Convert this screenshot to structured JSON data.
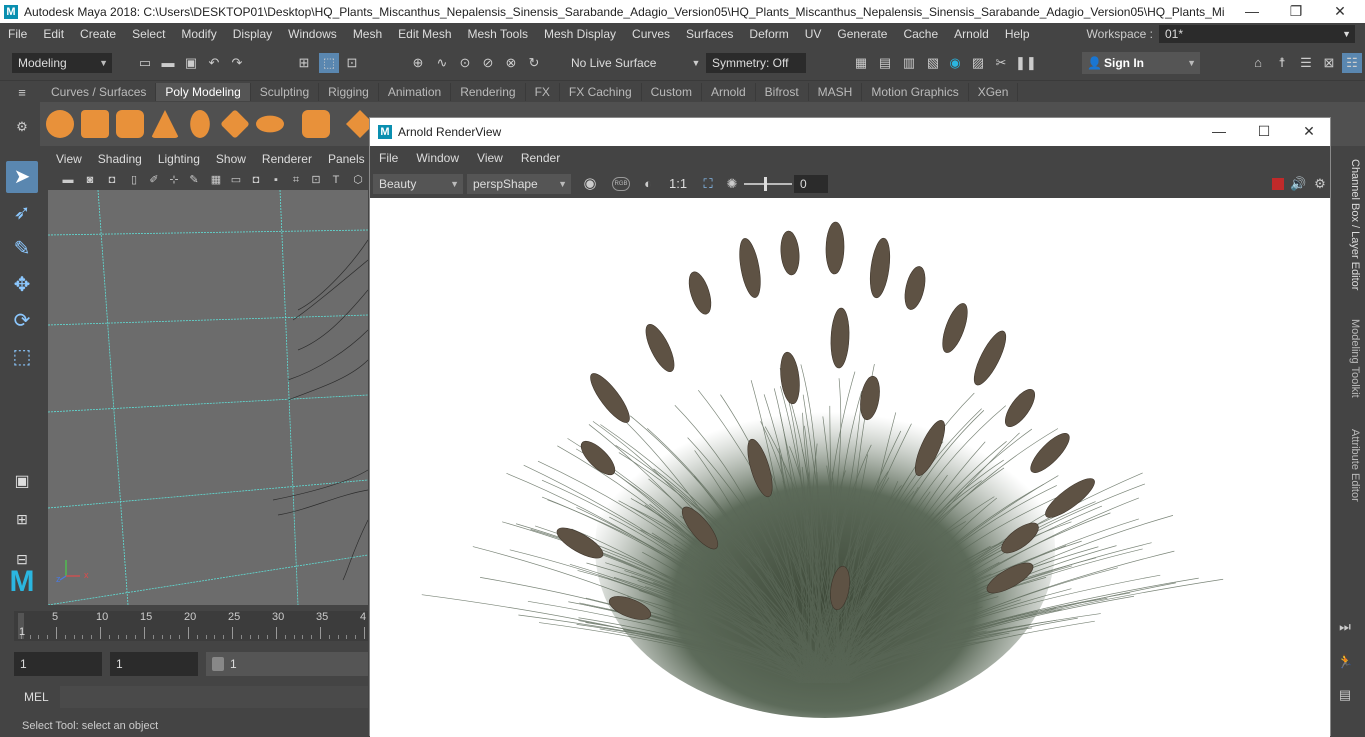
{
  "window": {
    "title": "Autodesk Maya 2018: C:\\Users\\DESKTOP01\\Desktop\\HQ_Plants_Miscanthus_Nepalensis_Sinensis_Sarabande_Adagio_Version05\\HQ_Plants_Miscanthus_Nepalensis_Sinensis_Sarabande_Adagio_Version05\\HQ_Plants_Miscanthus_...",
    "minimize": "—",
    "maximize": "❐",
    "close": "✕"
  },
  "menubar": {
    "items": [
      "File",
      "Edit",
      "Create",
      "Select",
      "Modify",
      "Display",
      "Windows",
      "Mesh",
      "Edit Mesh",
      "Mesh Tools",
      "Mesh Display",
      "Curves",
      "Surfaces",
      "Deform",
      "UV",
      "Generate",
      "Cache",
      "Arnold",
      "Help"
    ]
  },
  "workspace": {
    "label": "Workspace :",
    "value": "01*"
  },
  "statusline": {
    "mode": "Modeling",
    "live_surface": "No Live Surface",
    "symmetry": "Symmetry: Off",
    "sign_in": "Sign In"
  },
  "shelf": {
    "tabs": [
      "Curves / Surfaces",
      "Poly Modeling",
      "Sculpting",
      "Rigging",
      "Animation",
      "Rendering",
      "FX",
      "FX Caching",
      "Custom",
      "Arnold",
      "Bifrost",
      "MASH",
      "Motion Graphics",
      "XGen"
    ],
    "active_tab": "Poly Modeling"
  },
  "viewport": {
    "menu": [
      "View",
      "Shading",
      "Lighting",
      "Show",
      "Renderer",
      "Panels"
    ],
    "axis_x": "x",
    "axis_z": "z"
  },
  "timeline": {
    "ticks": [
      "5",
      "10",
      "15",
      "20",
      "25",
      "30",
      "35",
      "4"
    ],
    "current_frame": "1"
  },
  "range": {
    "start": "1",
    "start2": "1",
    "slider_value": "1"
  },
  "mel": {
    "label": "MEL"
  },
  "help": {
    "text": "Select Tool: select an object"
  },
  "right_tabs": [
    "Channel Box / Layer Editor",
    "Modeling Toolkit",
    "Attribute Editor"
  ],
  "arnold": {
    "title": "Arnold RenderView",
    "menu": [
      "File",
      "Window",
      "View",
      "Render"
    ],
    "aov": "Beauty",
    "camera": "perspShape",
    "rgb_label": "RGB",
    "ratio": "1:1",
    "exposure": "0"
  },
  "colors": {
    "ui_bg": "#444444",
    "field_bg": "#2b2b2b",
    "shelf_orange": "#e8913a",
    "grid_cyan": "#5fe0d8",
    "maya_teal": "#0a8fb0"
  }
}
